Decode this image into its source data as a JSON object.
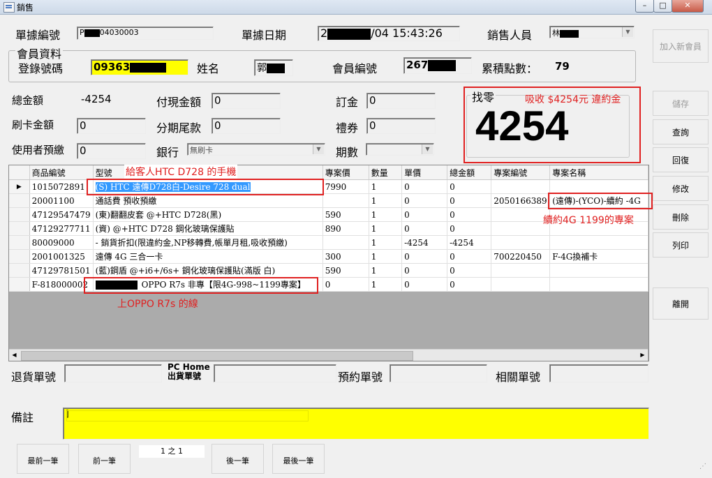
{
  "window": {
    "title": "銷售",
    "controls": [
      "–",
      "□",
      "✕"
    ]
  },
  "header": {
    "doc_no_label": "單據編號",
    "doc_no_value": "P",
    "doc_no_suffix": "04030003",
    "doc_date_label": "單據日期",
    "doc_date_prefix": "2",
    "doc_date_suffix": "/04 15:43:26",
    "sales_label": "銷售人員",
    "sales_value": "林"
  },
  "member": {
    "group_label": "會員資料",
    "login_label": "登錄號碼",
    "login_value": "09363",
    "name_label": "姓名",
    "name_value": "郭",
    "member_no_label": "會員編號",
    "member_no_value": "267",
    "points_label": "累積點數：",
    "points_value": "79"
  },
  "payment": {
    "total_label": "總金額",
    "total_value": "-4254",
    "cash_label": "付現金額",
    "cash_value": "0",
    "deposit_label": "訂金",
    "deposit_value": "0",
    "card_label": "刷卡金額",
    "card_value": "0",
    "installment_label": "分期尾款",
    "installment_value": "0",
    "voucher_label": "禮券",
    "voucher_value": "0",
    "prepaid_label": "使用者預繳",
    "prepaid_value": "0",
    "bank_label": "銀行",
    "bank_value": "無刷卡",
    "period_label": "期數",
    "period_value": ""
  },
  "change": {
    "label": "找零",
    "value": "4254",
    "annotation": "吸收 $4254元 違約金"
  },
  "buttons": {
    "add_member": "加入新會員",
    "save": "儲存",
    "query": "查詢",
    "restore": "回復",
    "modify": "修改",
    "delete": "刪除",
    "print": "列印",
    "leave": "離開"
  },
  "grid": {
    "headers": [
      "商品編號",
      "型號",
      "專案價",
      "數量",
      "單價",
      "總金額",
      "專案編號",
      "專案名稱"
    ],
    "rows": [
      [
        "1015072891",
        "(S) HTC 遠傳D728白-Desire 728 dual",
        "7990",
        "1",
        "0",
        "0",
        "",
        ""
      ],
      [
        "20001100",
        "通話費 預收預繳",
        "",
        "1",
        "0",
        "0",
        "2050166389",
        "(遠傳)-(YCO)-續約 -4G"
      ],
      [
        "47129547479",
        "(東)翻翻皮套 @+HTC D728(黑)",
        "590",
        "1",
        "0",
        "0",
        "",
        ""
      ],
      [
        "47129277711",
        "(資) @+HTC D728 鋼化玻璃保護貼",
        "890",
        "1",
        "0",
        "0",
        "",
        ""
      ],
      [
        "80009000",
        "- 銷貨折扣(限違約金,NP移轉費,帳單月租,吸收預繳)",
        "",
        "1",
        "-4254",
        "-4254",
        "",
        ""
      ],
      [
        "2001001325",
        "遠傳 4G 三合一卡",
        "300",
        "1",
        "0",
        "0",
        "700220450",
        "F-4G換補卡"
      ],
      [
        "47129781501",
        "(藍)鋼盾 @+i6+/6s+ 鋼化玻璃保護貼(滿版 白)",
        "590",
        "1",
        "0",
        "0",
        "",
        ""
      ],
      [
        "F-818000002",
        "OPPO R7s 非專【限4G-998~1199專案】",
        "0",
        "1",
        "0",
        "0",
        "",
        ""
      ]
    ],
    "current_row_marker": "▶"
  },
  "annotations": {
    "htc": "給客人HTC D728 的手機",
    "renew": "續約4G 1199的專案",
    "oppo": "上OPPO R7s 的線"
  },
  "bottom": {
    "return_label": "退貨單號",
    "return_value": "",
    "pchome_label_1": "PC Home",
    "pchome_label_2": "出貨單號",
    "pchome_value": "",
    "reserve_label": "預約單號",
    "reserve_value": "",
    "related_label": "相關單號",
    "related_value": "",
    "remark_label": "備註",
    "remark_value": "]"
  },
  "nav": {
    "first": "最前一筆",
    "prev": "前一筆",
    "page": "1 之 1",
    "next": "後一筆",
    "last": "最後一筆"
  },
  "colors": {
    "highlight": "#ffff00",
    "annotation": "#e02020",
    "selection": "#3399ff"
  }
}
